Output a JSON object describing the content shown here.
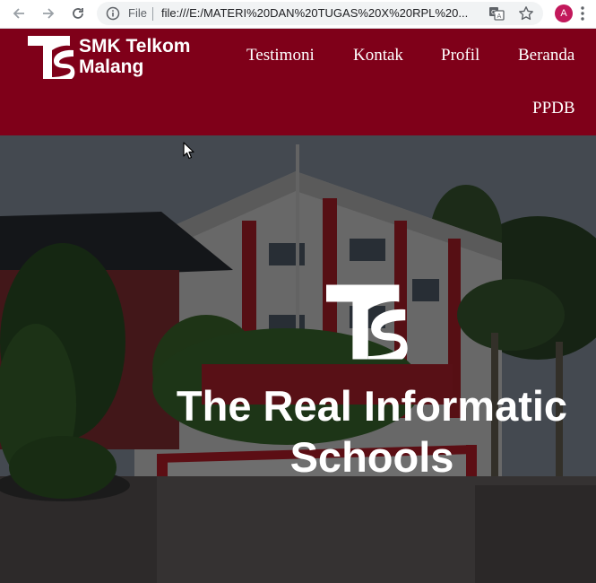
{
  "browser": {
    "scheme_label": "File",
    "url": "file:///E:/MATERI%20DAN%20TUGAS%20X%20RPL%20...",
    "avatar_letter": "A"
  },
  "site": {
    "brand_line1": "SMK Telkom",
    "brand_line2": "Malang",
    "nav": {
      "testimoni": "Testimoni",
      "kontak": "Kontak",
      "profil": "Profil",
      "beranda": "Beranda",
      "ppdb": "PPDB"
    }
  },
  "hero": {
    "title_line1": "The Real Informatic",
    "title_line2": "Schools"
  },
  "colors": {
    "header_bg": "#7f0019",
    "text_light": "#ffffff",
    "chrome_bg": "#ffffff",
    "omnibox_bg": "#f1f3f4"
  },
  "icons": [
    "back-arrow-icon",
    "forward-arrow-icon",
    "reload-icon",
    "info-icon",
    "translate-icon",
    "star-icon",
    "menu-dots-icon",
    "telkom-ts-logo-icon",
    "mouse-cursor-icon"
  ]
}
